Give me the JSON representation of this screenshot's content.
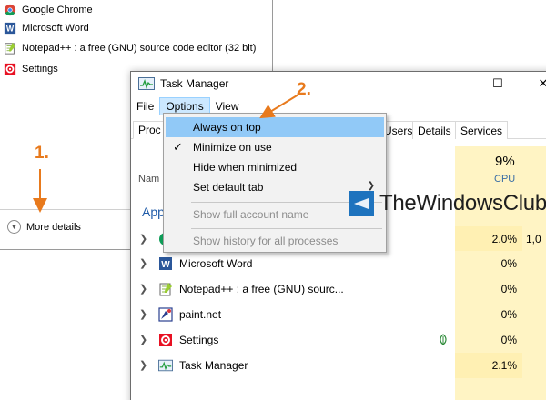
{
  "compact_view": {
    "apps": [
      {
        "name": "Google Chrome",
        "icon": "chrome-icon"
      },
      {
        "name": "Microsoft Word",
        "icon": "word-icon"
      },
      {
        "name": "Notepad++ : a free (GNU) source code editor (32 bit)",
        "icon": "notepadpp-icon"
      },
      {
        "name": "Settings",
        "icon": "settings-icon"
      }
    ],
    "more_details": "More details"
  },
  "window": {
    "title": "Task Manager",
    "controls": {
      "minimize": "—",
      "maximize": "☐",
      "close": "✕"
    }
  },
  "menubar": [
    "File",
    "Options",
    "View"
  ],
  "tabs": [
    "Proc",
    "Users",
    "Details",
    "Services"
  ],
  "columns": {
    "name": "Nam",
    "cpu_percent": "9%",
    "cpu": "CPU"
  },
  "apps_heading": "App",
  "processes": [
    {
      "name": "",
      "cpu": "2.0%",
      "mem": "1,0",
      "icon": "chrome-icon"
    },
    {
      "name": "Microsoft Word",
      "cpu": "0%",
      "mem": "",
      "icon": "word-icon"
    },
    {
      "name": "Notepad++ : a free (GNU) sourc...",
      "cpu": "0%",
      "mem": "",
      "icon": "notepadpp-icon"
    },
    {
      "name": "paint.net",
      "cpu": "0%",
      "mem": "",
      "icon": "paintnet-icon"
    },
    {
      "name": "Settings",
      "cpu": "0%",
      "mem": "",
      "icon": "settings-icon",
      "suspended": true
    },
    {
      "name": "Task Manager",
      "cpu": "2.1%",
      "mem": "",
      "icon": "taskmanager-icon"
    }
  ],
  "options_menu": [
    {
      "label": "Always on top",
      "highlighted": true,
      "checked": false,
      "disabled": false
    },
    {
      "label": "Minimize on use",
      "highlighted": false,
      "checked": true,
      "disabled": false
    },
    {
      "label": "Hide when minimized",
      "highlighted": false,
      "checked": false,
      "disabled": false
    },
    {
      "label": "Set default tab",
      "highlighted": false,
      "checked": false,
      "disabled": false,
      "submenu": true
    },
    {
      "label": "Show full account name",
      "highlighted": false,
      "checked": false,
      "disabled": true
    },
    {
      "label": "Show history for all processes",
      "highlighted": false,
      "checked": false,
      "disabled": true
    }
  ],
  "watermark": "TheWindowsClub",
  "annotations": {
    "step1": "1.",
    "step2": "2."
  },
  "colors": {
    "accent_annotation": "#e87a1d",
    "menu_highlight": "#91c9f7",
    "cpu_heat": "#fff4c4",
    "apps_heading": "#1e5aa8"
  }
}
